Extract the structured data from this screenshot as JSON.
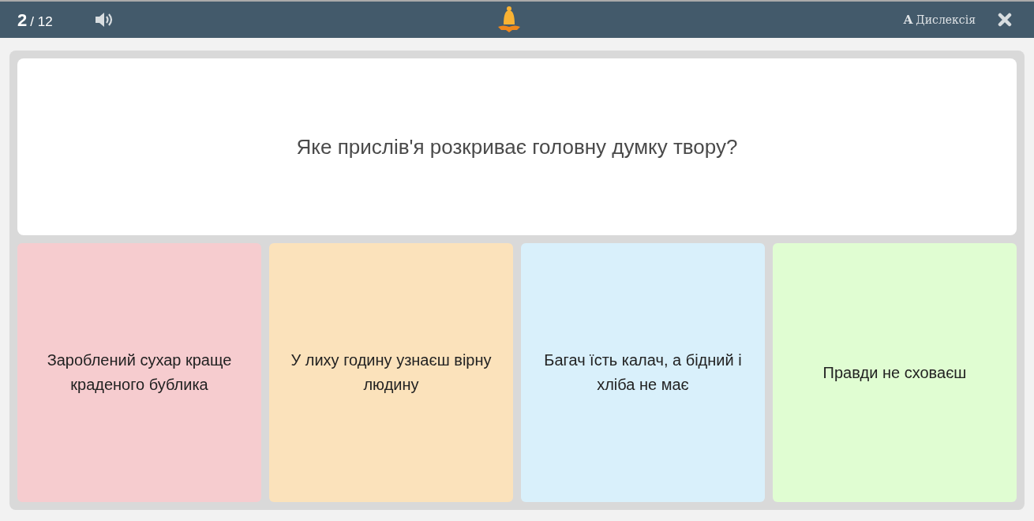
{
  "progress": {
    "current": "2",
    "total": "/ 12"
  },
  "toolbar": {
    "dyslexia_toggle": {
      "glyph": "A",
      "label": "Дислексія"
    }
  },
  "question": "Яке прислів'я розкриває головну думку твору?",
  "answers": [
    {
      "text": "Зароблений сухар краще краденого бублика",
      "color": "#f6cccf"
    },
    {
      "text": "У лиху годину узнаєш вірну людину",
      "color": "#fbe2bb"
    },
    {
      "text": "Багач їсть калач, а бідний і хліба не має",
      "color": "#d9f0fb"
    },
    {
      "text": "Правди не сховаєш",
      "color": "#e0fdd2"
    }
  ]
}
